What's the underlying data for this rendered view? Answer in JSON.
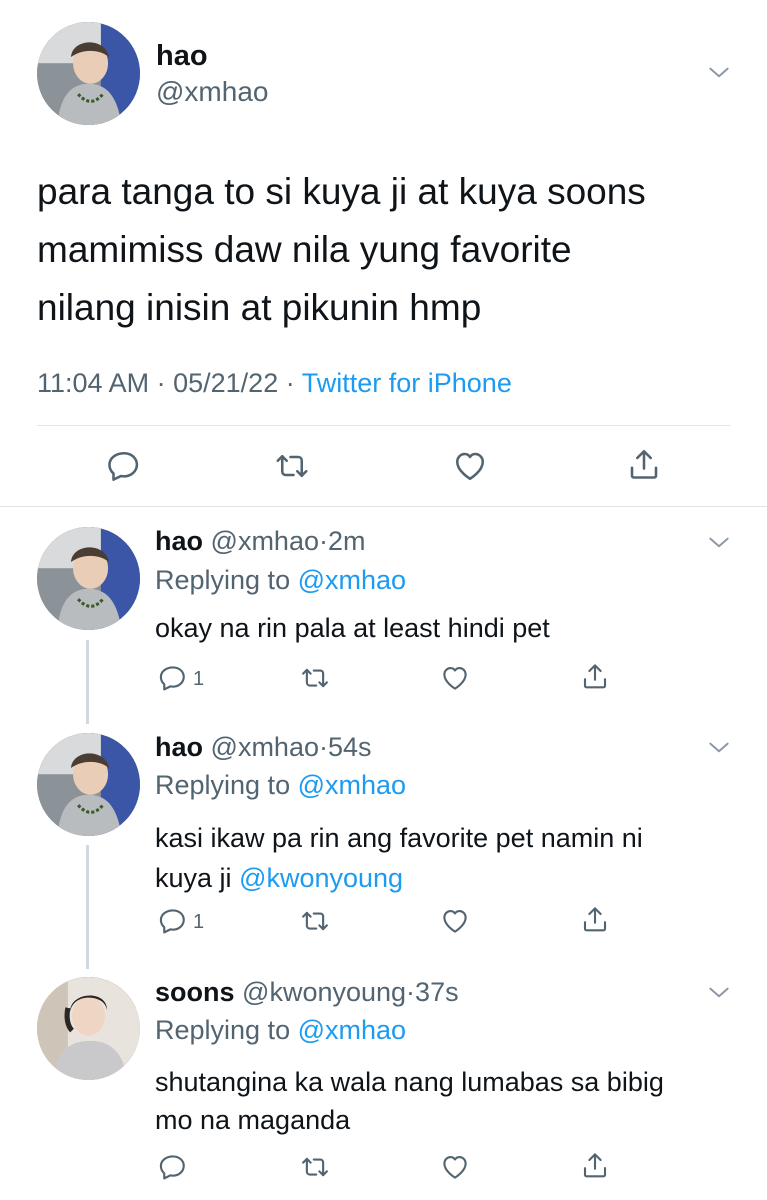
{
  "main_tweet": {
    "display_name": "hao",
    "handle": "@xmhao",
    "text_lines": [
      "para tanga to si kuya ji at kuya soons",
      "mamimiss daw nila yung favorite",
      "nilang inisin at pikunin hmp"
    ],
    "time": "11:04 AM",
    "date": "05/21/22",
    "source": "Twitter for iPhone",
    "sep": "·"
  },
  "replies": [
    {
      "display_name": "hao",
      "handle": "@xmhao",
      "age": "2m",
      "replying_label": "Replying to",
      "replying_to": "@xmhao",
      "text_lines": [
        "okay na rin pala at least hindi pet"
      ],
      "reply_count": "1"
    },
    {
      "display_name": "hao",
      "handle": "@xmhao",
      "age": "54s",
      "replying_label": "Replying to",
      "replying_to": "@xmhao",
      "text_line1": "kasi ikaw pa rin ang favorite pet namin ni",
      "text_line2_plain": "kuya ji",
      "text_line2_mention": "@kwonyoung",
      "reply_count": "1"
    },
    {
      "display_name": "soons",
      "handle": "@kwonyoung",
      "age": "37s",
      "replying_label": "Replying to",
      "replying_to": "@xmhao",
      "text_lines": [
        "shutangina ka wala nang lumabas sa bibig",
        "mo na maganda"
      ],
      "reply_count": ""
    }
  ],
  "icons": [
    "reply-icon",
    "retweet-icon",
    "like-icon",
    "share-icon",
    "chevron-down-icon"
  ],
  "colors": {
    "link": "#1d9bf0",
    "muted": "#536471",
    "line": "#cfd9de"
  }
}
